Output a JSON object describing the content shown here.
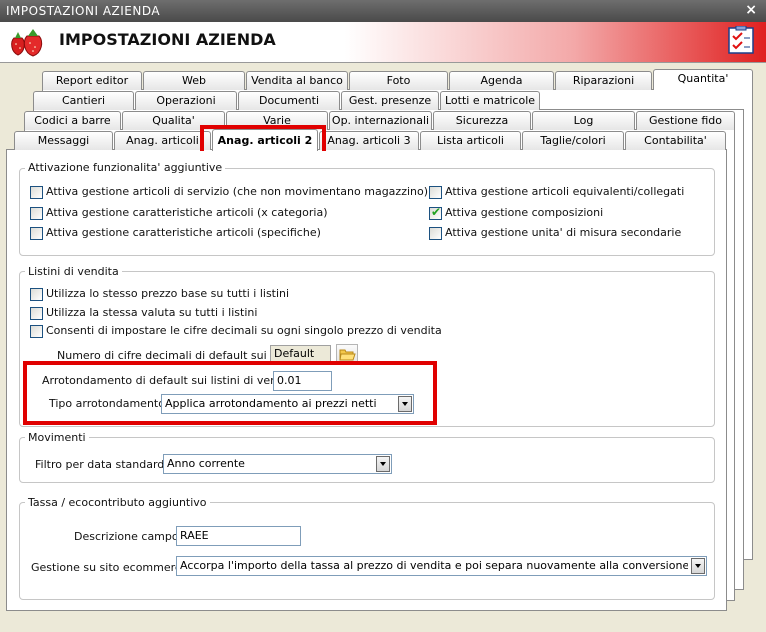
{
  "window": {
    "title": "IMPOSTAZIONI AZIENDA",
    "close_label": "×"
  },
  "header": {
    "title": "IMPOSTAZIONI AZIENDA",
    "logo_icon": "strawberry-icon",
    "right_icon": "checklist-icon"
  },
  "tabs": {
    "row1": [
      "Report editor",
      "Web",
      "Vendita al banco",
      "Foto",
      "Agenda",
      "Riparazioni",
      "Quantita'"
    ],
    "row2": [
      "Cantieri",
      "Operazioni",
      "Documenti",
      "Gest. presenze",
      "Lotti e matricole"
    ],
    "row3": [
      "Codici a barre",
      "Qualita'",
      "Varie",
      "Op. internazionali",
      "Sicurezza",
      "Log",
      "Gestione fido"
    ],
    "row4": [
      "Messaggi",
      "Anag. articoli",
      "Anag. articoli 2",
      "Anag. articoli 3",
      "Lista articoli",
      "Taglie/colori",
      "Contabilita'"
    ],
    "active": "Anag. articoli 2"
  },
  "attivazione": {
    "title": "Attivazione funzionalita' aggiuntive",
    "items": [
      {
        "label": "Attiva gestione articoli di servizio (che non movimentano magazzino)",
        "checked": false
      },
      {
        "label": "Attiva gestione caratteristiche articoli (x categoria)",
        "checked": false
      },
      {
        "label": "Attiva gestione caratteristiche articoli (specifiche)",
        "checked": false
      },
      {
        "label": "Attiva gestione articoli equivalenti/collegati",
        "checked": false
      },
      {
        "label": "Attiva gestione composizioni",
        "checked": true
      },
      {
        "label": "Attiva gestione unita' di misura secondarie",
        "checked": false
      }
    ],
    "check_glyph": "✔"
  },
  "listini": {
    "title": "Listini di vendita",
    "items": [
      {
        "label": "Utilizza lo stesso prezzo base su tutti i listini",
        "checked": false
      },
      {
        "label": "Utilizza la stessa valuta su tutti i listini",
        "checked": false
      },
      {
        "label": "Consenti di impostare le cifre decimali su ogni singolo prezzo di vendita",
        "checked": false
      }
    ],
    "decimali_label": "Numero di cifre decimali di default sui listini :",
    "decimali_value": "Default",
    "arrotondamento_label": "Arrotondamento di default sui listini di vendita :",
    "arrotondamento_value": "0.01",
    "tipo_label": "Tipo arrotondamento :",
    "tipo_value": "Applica arrotondamento ai prezzi netti"
  },
  "movimenti": {
    "title": "Movimenti",
    "filtro_label": "Filtro per data standard :",
    "filtro_value": "Anno corrente"
  },
  "tassa": {
    "title": "Tassa / ecocontributo aggiuntivo",
    "descrizione_label": "Descrizione campo :",
    "descrizione_value": "RAEE",
    "gestione_label": "Gestione su sito ecommerce :",
    "gestione_value": "Accorpa l'importo della tassa al prezzo di vendita e poi separa nuovamente alla conversione dell'ordine web"
  },
  "colors": {
    "highlight": "#e00000",
    "accent": "#e02020",
    "check": "#21a121"
  }
}
